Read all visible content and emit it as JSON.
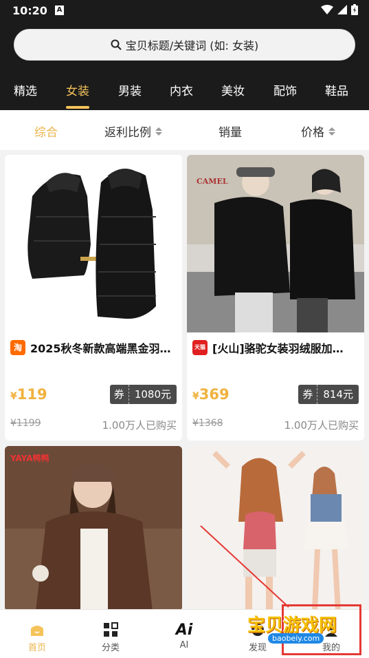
{
  "status_bar": {
    "time": "10:20",
    "notif_icon": "A"
  },
  "search": {
    "placeholder": "宝贝标题/关键词 (如: 女装)"
  },
  "categories": [
    "精选",
    "女装",
    "男装",
    "内衣",
    "美妆",
    "配饰",
    "鞋品"
  ],
  "active_category": "女装",
  "sort": {
    "items": [
      "综合",
      "返利比例",
      "销量",
      "价格"
    ],
    "active": "综合"
  },
  "products": [
    {
      "title": "2025秋冬新款高端黑金羽…",
      "platform_icon": "淘",
      "platform_color": "#ff6a00",
      "price_symbol": "¥",
      "price": "119",
      "coupon_label": "券",
      "coupon_value": "1080元",
      "original_price": "¥1199",
      "sold": "1.00万人已购买"
    },
    {
      "title": "[火山]骆驼女装羽绒服加…",
      "platform_icon": "天猫",
      "platform_color": "#e02020",
      "price_symbol": "¥",
      "price": "369",
      "coupon_label": "券",
      "coupon_value": "814元",
      "original_price": "¥1368",
      "sold": "1.00万人已购买"
    }
  ],
  "photo_text": {
    "camel_logo": "CAMEL",
    "brand_tag": "YAYA鸭鸭"
  },
  "tabs": [
    {
      "label": "首页",
      "icon": "home-icon"
    },
    {
      "label": "分类",
      "icon": "grid-icon"
    },
    {
      "label": "AI",
      "icon": "ai-icon"
    },
    {
      "label": "发现",
      "icon": "discover-icon"
    },
    {
      "label": "我的",
      "icon": "profile-icon"
    }
  ],
  "watermark": {
    "text": "宝贝游戏网",
    "url": "baobeiy.com"
  },
  "colors": {
    "accent": "#f4c35a",
    "header_bg": "#1b1b1b",
    "price": "#f0b23e"
  }
}
